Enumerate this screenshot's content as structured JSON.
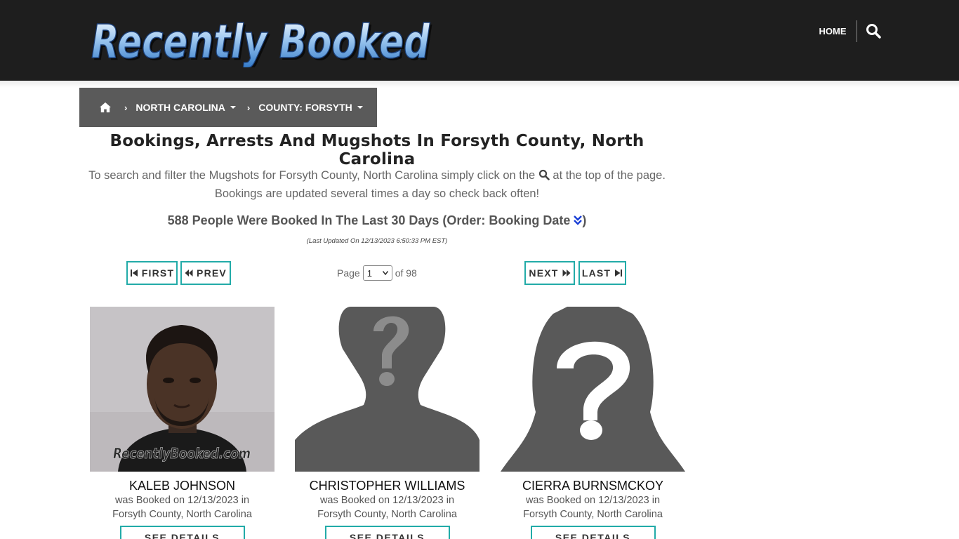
{
  "header": {
    "logo_text": "Recently Booked",
    "nav_home": "HOME",
    "search_icon": "magnifier-icon"
  },
  "breadcrumb": {
    "home_icon": "home-icon",
    "items": [
      {
        "label": "NORTH CAROLINA"
      },
      {
        "label": "COUNTY: FORSYTH"
      }
    ]
  },
  "page": {
    "title": "Bookings, Arrests And Mugshots In Forsyth County, North Carolina",
    "intro_before": "To search and filter the Mugshots for Forsyth County, North Carolina simply click on the",
    "intro_after": "at the top of the page.",
    "intro_line2": "Bookings are updated several times a day so check back often!",
    "count_text": "588 People Were Booked In The Last 30 Days (Order: Booking Date",
    "count_close": ")",
    "last_updated": "(Last Updated On 12/13/2023 6:50:33 PM EST)"
  },
  "pagination": {
    "first": "FIRST",
    "prev": "PREV",
    "next": "NEXT",
    "last": "LAST",
    "page_label": "Page",
    "current_page": "1",
    "of_label": "of 98"
  },
  "bookings": [
    {
      "name": "KALEB JOHNSON",
      "booked": "was Booked on 12/13/2023 in",
      "location": "Forsyth County, North Carolina",
      "photo": "mugshot-photo",
      "watermark": "RecentlyBooked.com",
      "details": "SEE DETAILS"
    },
    {
      "name": "CHRISTOPHER WILLIAMS",
      "booked": "was Booked on 12/13/2023 in",
      "location": "Forsyth County, North Carolina",
      "photo": "male-placeholder-silhouette",
      "details": "SEE DETAILS"
    },
    {
      "name": "CIERRA BURNSMCKOY",
      "booked": "was Booked on 12/13/2023 in",
      "location": "Forsyth County, North Carolina",
      "photo": "female-placeholder-silhouette",
      "details": "SEE DETAILS"
    }
  ],
  "colors": {
    "header_bg": "#1e1e1e",
    "breadcrumb_bg": "#5a5a5a",
    "button_border": "#22aba8",
    "order_icon": "#1a3fd6",
    "silhouette": "#595959"
  }
}
